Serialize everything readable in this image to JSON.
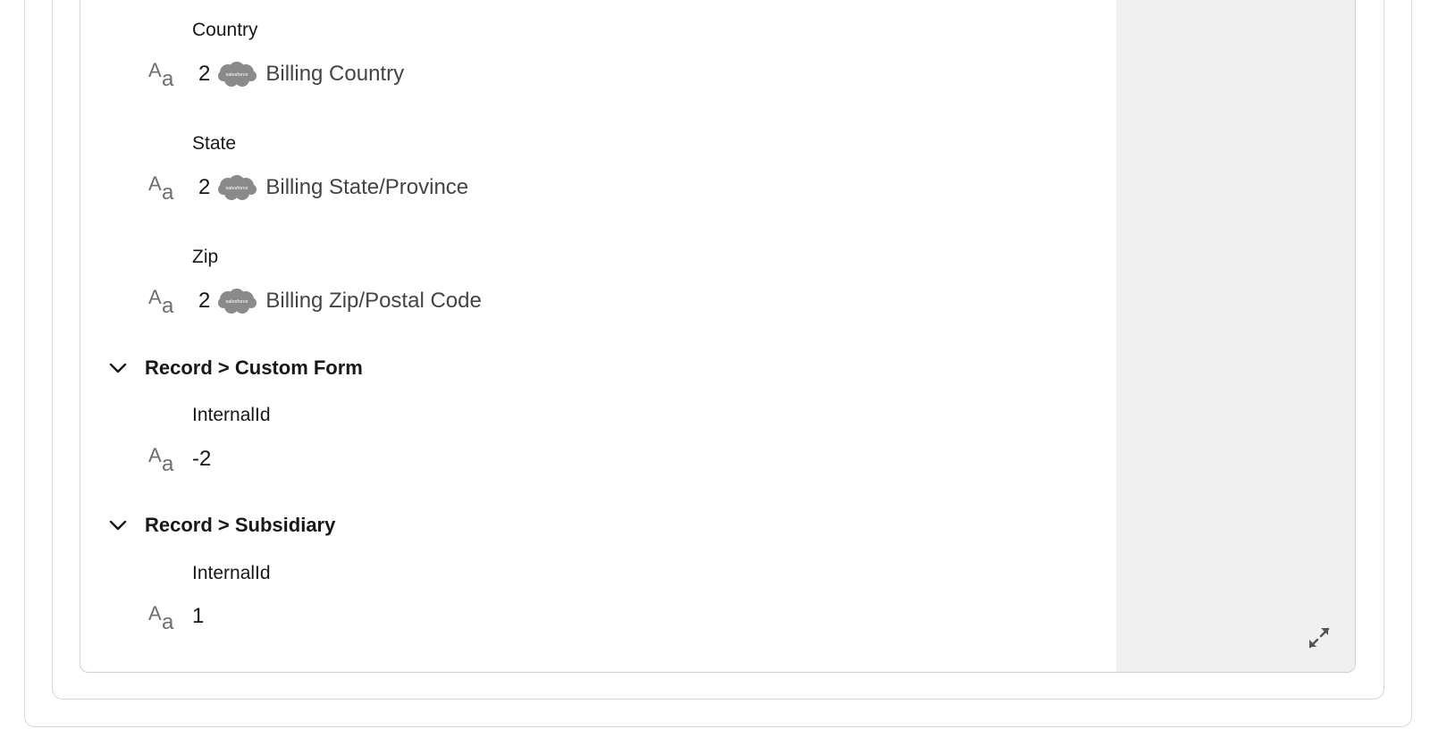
{
  "fields": [
    {
      "label": "Country",
      "value": "2",
      "source_field": "Billing Country"
    },
    {
      "label": "State",
      "value": "2",
      "source_field": "Billing State/Province"
    },
    {
      "label": "Zip",
      "value": "2",
      "source_field": "Billing Zip/Postal Code"
    }
  ],
  "sections": [
    {
      "title": "Record > Custom Form",
      "field_label": "InternalId",
      "value": "-2"
    },
    {
      "title": "Record > Subsidiary",
      "field_label": "InternalId",
      "value": "1"
    }
  ],
  "icons": {
    "text_type": "text-type-icon",
    "source_logo": "salesforce-cloud-icon",
    "chevron": "chevron-down-icon",
    "expand": "expand-icon"
  },
  "source_logo_text": "salesforce",
  "text_type_glyphs": {
    "cap": "A",
    "low": "a"
  },
  "colors": {
    "side_panel": "#f0f0f0",
    "icon_gray": "#706e6b",
    "logo_gray": "#8a8a8a",
    "border": "#d8d8d8"
  }
}
